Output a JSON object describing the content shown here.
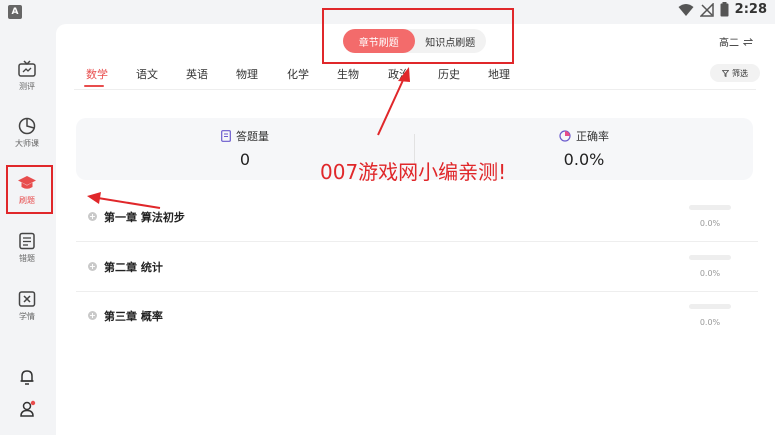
{
  "status_bar": {
    "app_badge": "A",
    "time": "2:28"
  },
  "sidebar": {
    "items": [
      {
        "label": "测评",
        "icon": "tv-icon"
      },
      {
        "label": "大师课",
        "icon": "pie-chart-icon"
      },
      {
        "label": "刷题",
        "icon": "graduation-cap-icon",
        "active": true
      },
      {
        "label": "错题",
        "icon": "notebook-icon"
      },
      {
        "label": "学情",
        "icon": "report-icon"
      }
    ],
    "bottom": [
      "bell-icon",
      "user-icon"
    ]
  },
  "header": {
    "segments": [
      {
        "label": "章节刷题",
        "active": true
      },
      {
        "label": "知识点刷题",
        "active": false
      }
    ],
    "grade": "高二",
    "filter_label": "筛选"
  },
  "tabs": [
    {
      "label": "数学",
      "active": true
    },
    {
      "label": "语文"
    },
    {
      "label": "英语"
    },
    {
      "label": "物理"
    },
    {
      "label": "化学"
    },
    {
      "label": "生物"
    },
    {
      "label": "政治"
    },
    {
      "label": "历史"
    },
    {
      "label": "地理"
    }
  ],
  "stats": [
    {
      "label": "答题量",
      "value": "0",
      "icon": "document-icon"
    },
    {
      "label": "正确率",
      "value": "0.0%",
      "icon": "pie-icon"
    }
  ],
  "chapters": [
    {
      "title": "第一章  算法初步",
      "progress": 0,
      "percent_label": "0.0%"
    },
    {
      "title": "第二章  统计",
      "progress": 0,
      "percent_label": "0.0%"
    },
    {
      "title": "第三章  概率",
      "progress": 0,
      "percent_label": "0.0%"
    }
  ],
  "annotation": {
    "text": "007游戏网小编亲测!",
    "color": "#e0272a"
  },
  "colors": {
    "accent": "#e84d4d",
    "segment_active": "#f36b6b",
    "annotation": "#e0272a"
  }
}
